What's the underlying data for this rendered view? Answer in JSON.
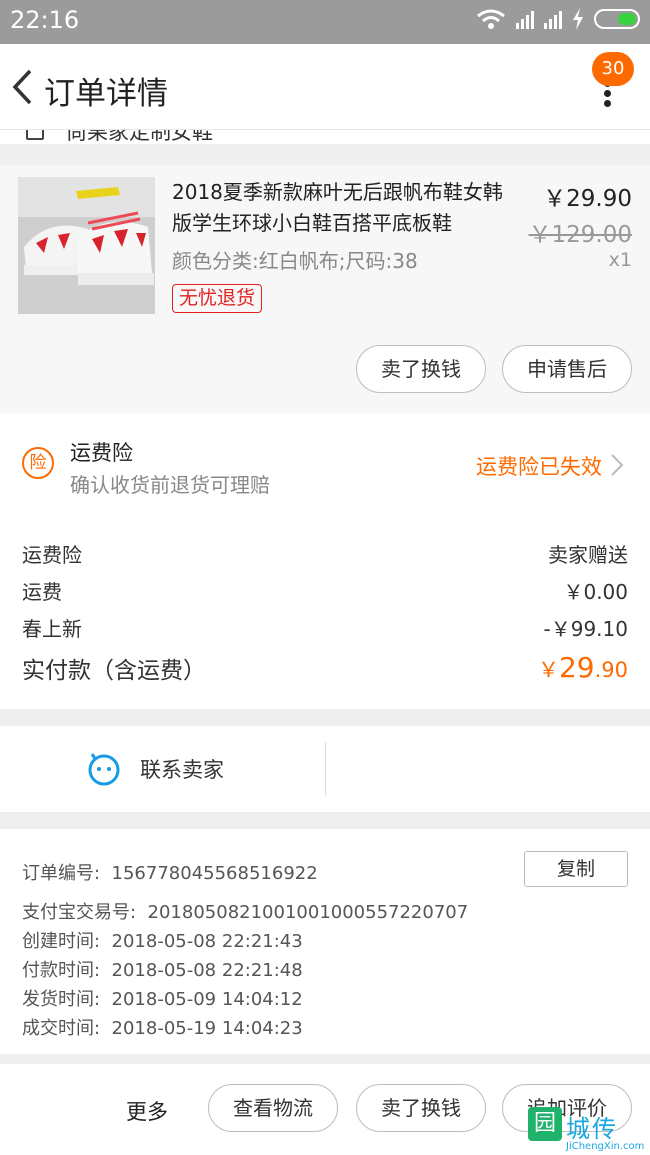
{
  "status_bar": {
    "time": "22:16"
  },
  "header": {
    "title": "订单详情",
    "badge": "30"
  },
  "shop": {
    "name": "尚果家定制女鞋"
  },
  "product": {
    "title": "2018夏季新款麻叶无后跟帆布鞋女韩版学生环球小白鞋百搭平底板鞋",
    "spec": "颜色分类:红白帆布;尺码:38",
    "tag": "无忧退货",
    "price": "￥29.90",
    "original_price": "￥129.00",
    "quantity": "x1",
    "buttons": {
      "sell": "卖了换钱",
      "after_sale": "申请售后"
    }
  },
  "insurance": {
    "icon_text": "险",
    "title": "运费险",
    "subtitle": "确认收货前退货可理赔",
    "status": "运费险已失效"
  },
  "fees": [
    {
      "label": "运费险",
      "value": "卖家赠送"
    },
    {
      "label": "运费",
      "value": "￥0.00"
    },
    {
      "label": "春上新",
      "value": "-￥99.10"
    }
  ],
  "total": {
    "label": "实付款（含运费）",
    "currency": "￥",
    "integer": "29",
    "decimal": ".90"
  },
  "contact": {
    "label": "联系卖家"
  },
  "order_info": {
    "copy_label": "复制",
    "rows": [
      {
        "label": "订单编号:",
        "value": "156778045568516922"
      },
      {
        "label": "支付宝交易号:",
        "value": "2018050821001001000557220707"
      },
      {
        "label": "创建时间:",
        "value": "2018-05-08 22:21:43"
      },
      {
        "label": "付款时间:",
        "value": "2018-05-08 22:21:48"
      },
      {
        "label": "发货时间:",
        "value": "2018-05-09 14:04:12"
      },
      {
        "label": "成交时间:",
        "value": "2018-05-19 14:04:23"
      }
    ]
  },
  "bottom_bar": {
    "more": "更多",
    "logistics": "查看物流",
    "sell": "卖了换钱",
    "review": "追加评价"
  },
  "watermark": {
    "logo": "园",
    "name": "城传",
    "url": "JiChengXin.com"
  },
  "colors": {
    "accent": "#ff6a00",
    "refund_tag": "#e02222",
    "chat_blue": "#1a9be6"
  }
}
